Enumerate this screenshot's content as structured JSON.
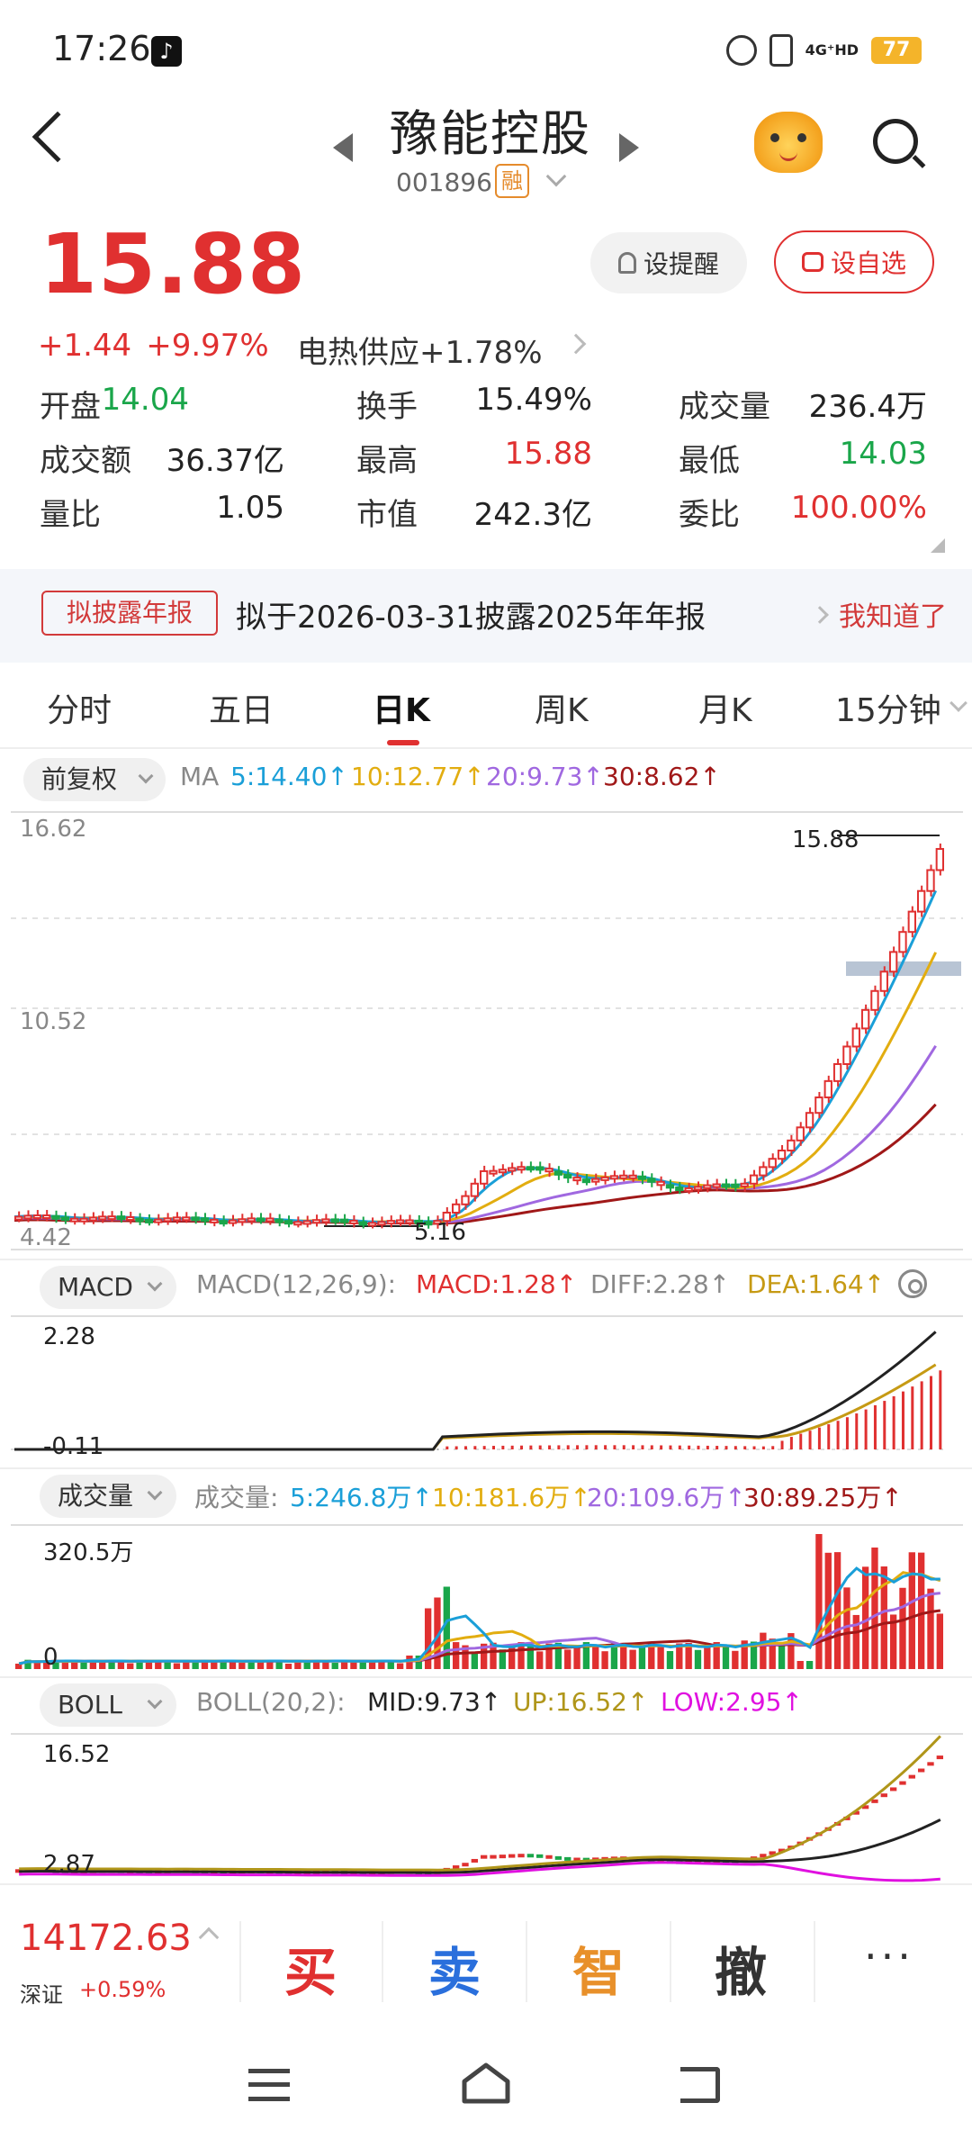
{
  "status": {
    "time": "17:26",
    "network": "4G⁺HD",
    "battery": "77"
  },
  "header": {
    "stock_name": "豫能控股",
    "stock_code": "001896",
    "badge": "融"
  },
  "quote": {
    "price": "15.88",
    "change": "+1.44",
    "change_pct": "+9.97%",
    "sector": "电热供应",
    "sector_change": "+1.78%",
    "remind_label": "设提醒",
    "fav_label": "设自选"
  },
  "stats": [
    {
      "label": "开盘",
      "value": "14.04",
      "color": "green"
    },
    {
      "label": "换手",
      "value": "15.49%",
      "color": "dark"
    },
    {
      "label": "成交量",
      "value": "236.4万",
      "color": "dark"
    },
    {
      "label": "成交额",
      "value": "36.37亿",
      "color": "dark"
    },
    {
      "label": "最高",
      "value": "15.88",
      "color": "red"
    },
    {
      "label": "最低",
      "value": "14.03",
      "color": "green"
    },
    {
      "label": "量比",
      "value": "1.05",
      "color": "dark"
    },
    {
      "label": "市值",
      "value": "242.3亿",
      "color": "dark"
    },
    {
      "label": "委比",
      "value": "100.00%",
      "color": "red"
    }
  ],
  "notice": {
    "badge": "拟披露年报",
    "text": "拟于2026-03-31披露2025年年报",
    "ok": "我知道了"
  },
  "tabs": [
    "分时",
    "五日",
    "日K",
    "周K",
    "月K",
    "15分钟"
  ],
  "kline": {
    "adjust": "前复权",
    "ma_label": "MA",
    "ma5": "5:14.40↑",
    "ma10": "10:12.77↑",
    "ma20": "20:9.73↑",
    "ma30": "30:8.62↑",
    "y_top": "16.62",
    "y_mid": "10.52",
    "y_bottom": "4.42",
    "max_label": "15.88",
    "min_label": "5.16"
  },
  "macd": {
    "name": "MACD",
    "params": "MACD(12,26,9):",
    "macd": "MACD:1.28↑",
    "diff": "DIFF:2.28↑",
    "dea": "DEA:1.64↑",
    "y_top": "2.28",
    "y_bottom": "-0.11"
  },
  "volume": {
    "name": "成交量",
    "label": "成交量:",
    "ma5": "5:246.8万↑",
    "ma10": "10:181.6万↑",
    "ma20": "20:109.6万↑",
    "ma30": "30:89.25万↑",
    "y_top": "320.5万",
    "y_bottom": "0"
  },
  "boll": {
    "name": "BOLL",
    "params": "BOLL(20,2):",
    "mid": "MID:9.73↑",
    "up": "UP:16.52↑",
    "low": "LOW:2.95↑",
    "y_top": "16.52",
    "y_bottom": "2.87"
  },
  "bottom": {
    "index_value": "14172.63",
    "index_name": "深证",
    "index_change": "+0.59%",
    "buy": "买",
    "sell": "卖",
    "smart": "智",
    "cancel": "撤",
    "more": "···"
  },
  "colors": {
    "up": "#e03030",
    "down": "#1aa64a",
    "ma5": "#1a9fd8",
    "ma10": "#e2ad10",
    "ma20": "#a068e0",
    "ma30": "#a01818"
  }
}
